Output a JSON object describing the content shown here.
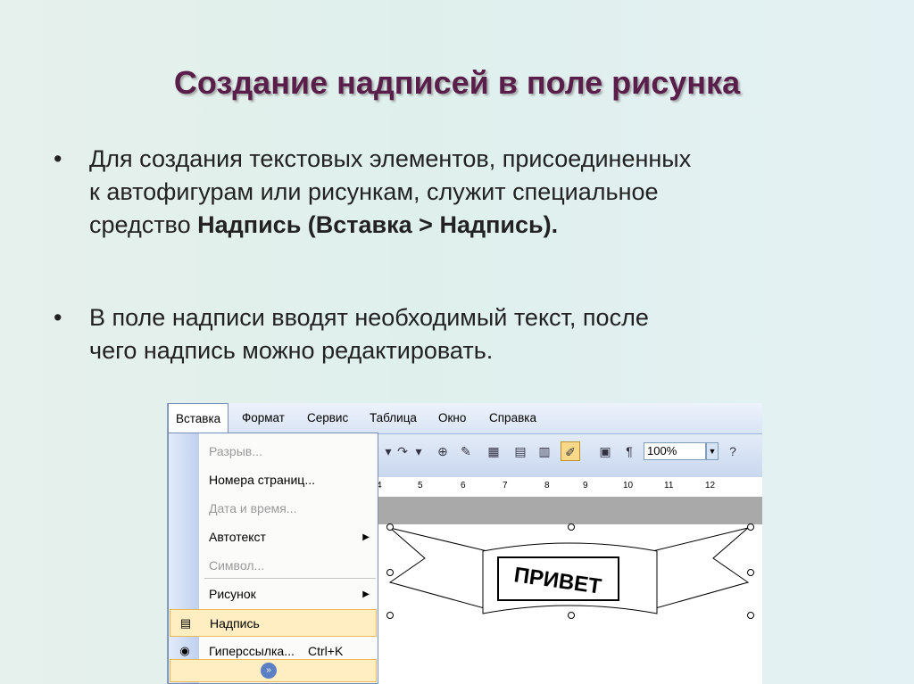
{
  "slide": {
    "title": "Создание надписей в поле рисунка",
    "bullet_char": "•",
    "bullet1": {
      "line1": "Для создания текстовых элементов, присоединенных",
      "line2": "к автофигурам или рисункам, служит специальное",
      "line3_plain": "средство ",
      "line3_bold": "Надпись (Вставка > Надпись)."
    },
    "bullet2": {
      "line1": "В поле надписи вводят необходимый текст, после",
      "line2": "чего надпись можно редактировать."
    }
  },
  "screenshot": {
    "menu": [
      "Вставка",
      "Формат",
      "Сервис",
      "Таблица",
      "Окно",
      "Справка"
    ],
    "zoom": "100%",
    "ruler": [
      "4",
      "5",
      "6",
      "7",
      "8",
      "9",
      "10",
      "11",
      "12"
    ],
    "dropdown": {
      "items": [
        {
          "label": "Разрыв...",
          "disabled": true
        },
        {
          "label": "Номера страниц...",
          "disabled": false
        },
        {
          "label": "Дата и время...",
          "disabled": true
        },
        {
          "label": "Автотекст",
          "disabled": false,
          "submenu": true
        },
        {
          "label": "Символ...",
          "disabled": true
        },
        {
          "label": "Рисунок",
          "disabled": false,
          "submenu": true
        },
        {
          "label": "Надпись",
          "disabled": false,
          "highlighted": true
        },
        {
          "label": "Гиперссылка...",
          "disabled": false,
          "shortcut": "Ctrl+K"
        }
      ]
    },
    "banner_text": "ПРИВЕТ"
  },
  "colors": {
    "title": "#5a1e4a",
    "highlight": "#ffeec2",
    "highlight_border": "#e8b85a"
  }
}
